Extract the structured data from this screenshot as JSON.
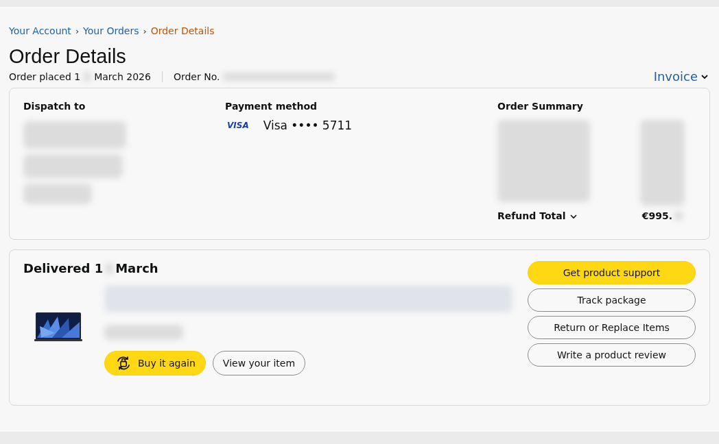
{
  "breadcrumbs": [
    {
      "label": "Your Account",
      "selected": false
    },
    {
      "label": "Your Orders",
      "selected": false
    },
    {
      "label": "Order Details",
      "selected": true
    }
  ],
  "breadcrumb_separator": "›",
  "title": "Order Details",
  "order_placed": {
    "before": "Order placed 1",
    "after": "March 2026"
  },
  "order_number": {
    "label": "Order No."
  },
  "invoice": {
    "label": "Invoice"
  },
  "dispatch": {
    "heading": "Dispatch to"
  },
  "payment": {
    "heading": "Payment method",
    "brand": "VISA",
    "card": "Visa •••• 5711"
  },
  "summary": {
    "heading": "Order Summary",
    "total_label": "Refund Total",
    "total_value": "€995."
  },
  "shipment": {
    "status_before": "Delivered 1",
    "status_after": "March",
    "item": {
      "buttons": [
        {
          "label": "Buy it again",
          "kind": "primary"
        },
        {
          "label": "View your item",
          "kind": "secondary"
        }
      ]
    },
    "actions": [
      {
        "label": "Get product support",
        "kind": "primary"
      },
      {
        "label": "Track package",
        "kind": "secondary"
      },
      {
        "label": "Return or Replace Items",
        "kind": "secondary"
      },
      {
        "label": "Write a product review",
        "kind": "secondary"
      }
    ]
  }
}
